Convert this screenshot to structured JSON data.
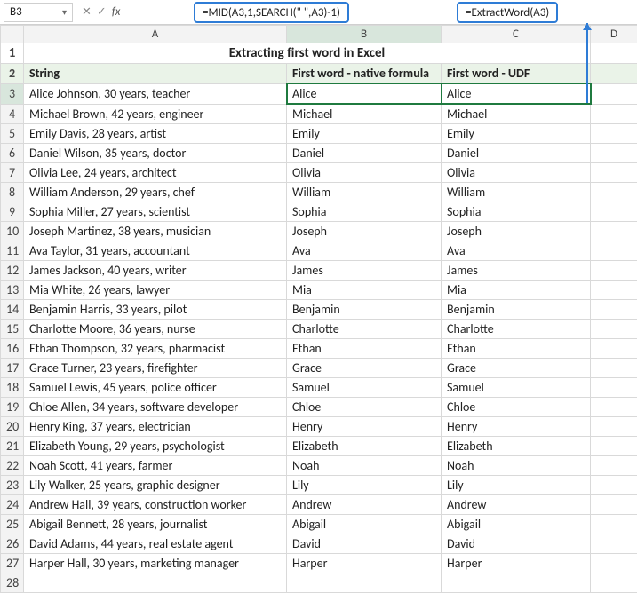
{
  "nameBox": "B3",
  "formula1": "=MID(A3,1,SEARCH(\" \",A3)-1)",
  "formula2": "=ExtractWord(A3)",
  "colHeads": {
    "A": "A",
    "B": "B",
    "C": "C",
    "D": "D"
  },
  "title": "Extracting first word in Excel",
  "headers": {
    "A": "String",
    "B": "First word - native formula",
    "C": "First word - UDF"
  },
  "rows": [
    {
      "n": "3",
      "a": "Alice Johnson, 30 years, teacher",
      "b": "Alice",
      "c": "Alice"
    },
    {
      "n": "4",
      "a": "Michael Brown, 42 years, engineer",
      "b": "Michael",
      "c": "Michael"
    },
    {
      "n": "5",
      "a": "Emily Davis, 28 years, artist",
      "b": "Emily",
      "c": "Emily"
    },
    {
      "n": "6",
      "a": "Daniel Wilson, 35 years, doctor",
      "b": "Daniel",
      "c": "Daniel"
    },
    {
      "n": "7",
      "a": "Olivia Lee, 24 years, architect",
      "b": "Olivia",
      "c": "Olivia"
    },
    {
      "n": "8",
      "a": "William Anderson, 29 years, chef",
      "b": "William",
      "c": "William"
    },
    {
      "n": "9",
      "a": "Sophia Miller, 27 years, scientist",
      "b": "Sophia",
      "c": "Sophia"
    },
    {
      "n": "10",
      "a": "Joseph Martinez, 38 years, musician",
      "b": "Joseph",
      "c": "Joseph"
    },
    {
      "n": "11",
      "a": "Ava Taylor, 31 years, accountant",
      "b": "Ava",
      "c": "Ava"
    },
    {
      "n": "12",
      "a": "James Jackson, 40 years, writer",
      "b": "James",
      "c": "James"
    },
    {
      "n": "13",
      "a": "Mia White, 26 years, lawyer",
      "b": "Mia",
      "c": "Mia"
    },
    {
      "n": "14",
      "a": "Benjamin Harris, 33 years, pilot",
      "b": "Benjamin",
      "c": "Benjamin"
    },
    {
      "n": "15",
      "a": "Charlotte Moore, 36 years, nurse",
      "b": "Charlotte",
      "c": "Charlotte"
    },
    {
      "n": "16",
      "a": "Ethan Thompson, 32 years, pharmacist",
      "b": "Ethan",
      "c": "Ethan"
    },
    {
      "n": "17",
      "a": "Grace Turner, 23 years, firefighter",
      "b": "Grace",
      "c": "Grace"
    },
    {
      "n": "18",
      "a": "Samuel Lewis, 45 years, police officer",
      "b": "Samuel",
      "c": "Samuel"
    },
    {
      "n": "19",
      "a": "Chloe Allen, 34 years, software developer",
      "b": "Chloe",
      "c": "Chloe"
    },
    {
      "n": "20",
      "a": "Henry King, 37 years, electrician",
      "b": "Henry",
      "c": "Henry"
    },
    {
      "n": "21",
      "a": "Elizabeth Young, 29 years, psychologist",
      "b": "Elizabeth",
      "c": "Elizabeth"
    },
    {
      "n": "22",
      "a": "Noah Scott, 41 years, farmer",
      "b": "Noah",
      "c": "Noah"
    },
    {
      "n": "23",
      "a": "Lily Walker, 25 years, graphic designer",
      "b": "Lily",
      "c": "Lily"
    },
    {
      "n": "24",
      "a": "Andrew Hall, 39 years, construction worker",
      "b": "Andrew",
      "c": "Andrew"
    },
    {
      "n": "25",
      "a": "Abigail Bennett, 28 years, journalist",
      "b": "Abigail",
      "c": "Abigail"
    },
    {
      "n": "26",
      "a": "David Adams, 44 years, real estate agent",
      "b": "David",
      "c": "David"
    },
    {
      "n": "27",
      "a": "Harper Hall, 30 years, marketing manager",
      "b": "Harper",
      "c": "Harper"
    }
  ],
  "emptyRow": "28"
}
